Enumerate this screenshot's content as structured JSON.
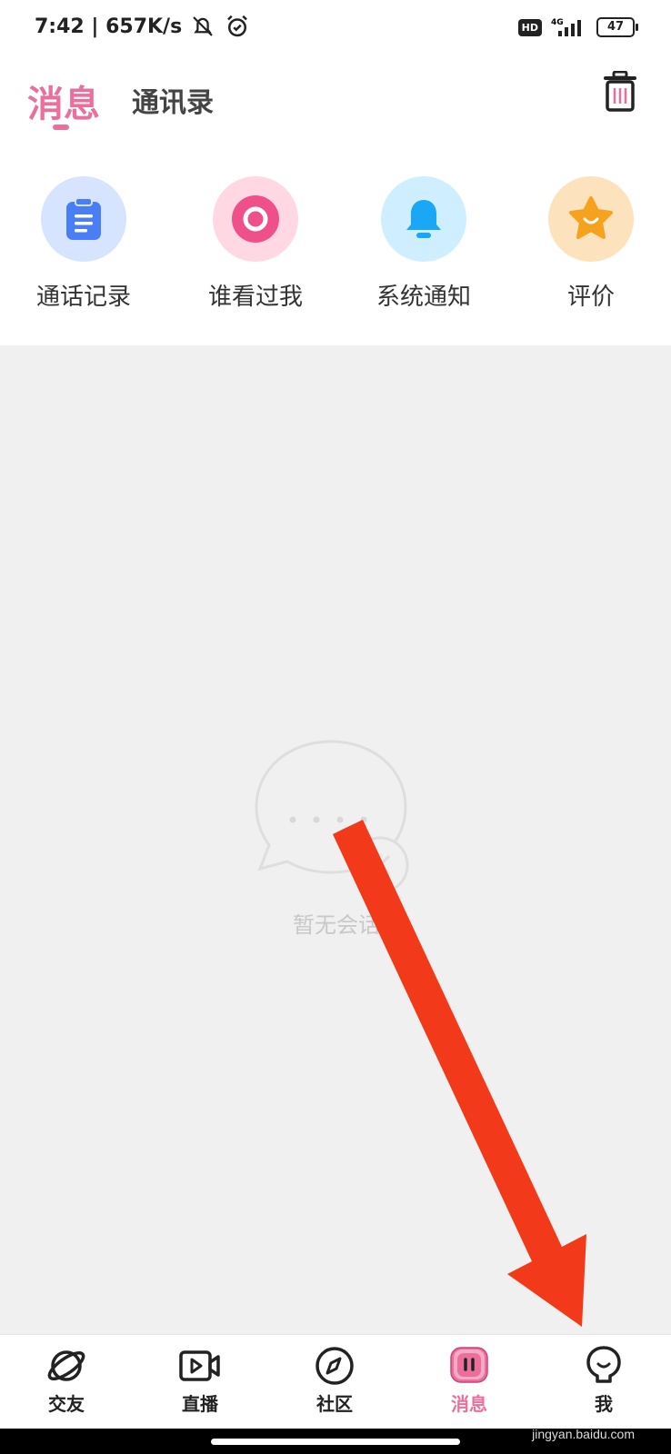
{
  "status_bar": {
    "time_speed": "7:42 | 657K/s",
    "hd": "HD",
    "network": "4G",
    "battery": "47"
  },
  "header": {
    "tab_messages": "消息",
    "tab_contacts": "通讯录"
  },
  "shortcuts": [
    {
      "label": "通话记录",
      "icon": "clipboard-icon",
      "bg": "#d6e4ff",
      "fg": "#4a7ef7"
    },
    {
      "label": "谁看过我",
      "icon": "eye-circle-icon",
      "bg": "#ffd8e4",
      "fg": "#f0508a"
    },
    {
      "label": "系统通知",
      "icon": "bell-icon",
      "bg": "#cfeeff",
      "fg": "#1aa7f5"
    },
    {
      "label": "评价",
      "icon": "star-icon",
      "bg": "#fde3bd",
      "fg": "#f6a21e"
    }
  ],
  "empty_state": {
    "text": "暂无会话"
  },
  "bottom_nav": [
    {
      "label": "交友",
      "icon": "planet-icon"
    },
    {
      "label": "直播",
      "icon": "video-camera-icon"
    },
    {
      "label": "社区",
      "icon": "compass-icon"
    },
    {
      "label": "消息",
      "icon": "message-icon",
      "active": true
    },
    {
      "label": "我",
      "icon": "profile-icon"
    }
  ],
  "watermark": "jingyan.baidu.com",
  "colors": {
    "accent": "#ea6f9a",
    "arrow": "#f23a1a"
  }
}
